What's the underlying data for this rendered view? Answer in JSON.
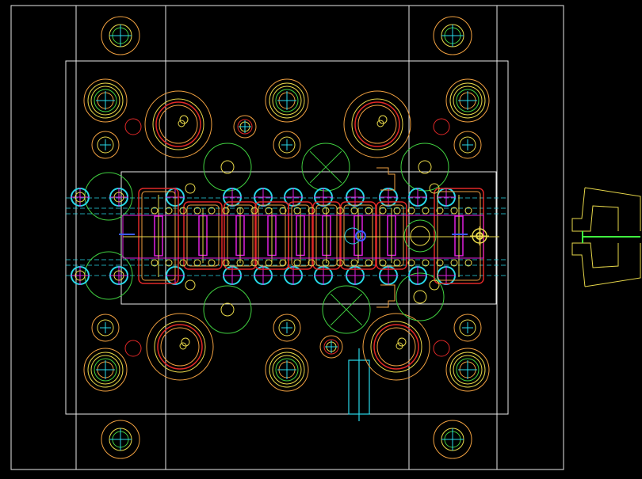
{
  "drawing": {
    "background": "#000000",
    "palette": {
      "outline": "#e8e8e8",
      "yellow": "#e8d84a",
      "orange": "#f0a040",
      "red": "#e02828",
      "green": "#40d040",
      "cyan": "#28d8e8",
      "magenta": "#e020e0",
      "blue": "#3a5cff",
      "pink": "#ff8080",
      "lime": "#40ff40"
    }
  }
}
